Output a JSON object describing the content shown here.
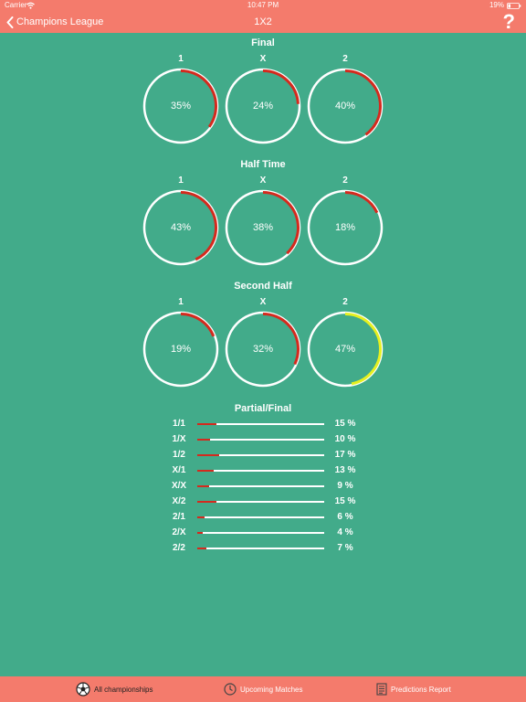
{
  "status": {
    "carrier": "Carrier",
    "time": "10:47 PM",
    "battery": "19%"
  },
  "nav": {
    "back_label": "Champions League",
    "title": "1X2",
    "help": "?"
  },
  "colors": {
    "background": "#42ab8a",
    "bar": "#f47b6c",
    "arc_red": "#d42a1e",
    "arc_yellow": "#e6f020"
  },
  "sections": [
    {
      "title": "Final",
      "gauges": [
        {
          "label": "1",
          "value": "35%",
          "fraction": 0.35,
          "highlight": false
        },
        {
          "label": "X",
          "value": "24%",
          "fraction": 0.24,
          "highlight": false
        },
        {
          "label": "2",
          "value": "40%",
          "fraction": 0.4,
          "highlight": false
        }
      ]
    },
    {
      "title": "Half Time",
      "gauges": [
        {
          "label": "1",
          "value": "43%",
          "fraction": 0.43,
          "highlight": false
        },
        {
          "label": "X",
          "value": "38%",
          "fraction": 0.38,
          "highlight": false
        },
        {
          "label": "2",
          "value": "18%",
          "fraction": 0.18,
          "highlight": false
        }
      ]
    },
    {
      "title": "Second Half",
      "gauges": [
        {
          "label": "1",
          "value": "19%",
          "fraction": 0.19,
          "highlight": false
        },
        {
          "label": "X",
          "value": "32%",
          "fraction": 0.32,
          "highlight": false
        },
        {
          "label": "2",
          "value": "47%",
          "fraction": 0.47,
          "highlight": true
        }
      ]
    }
  ],
  "partial_final": {
    "title": "Partial/Final",
    "rows": [
      {
        "label": "1/1",
        "value": "15 %",
        "fraction": 0.15
      },
      {
        "label": "1/X",
        "value": "10 %",
        "fraction": 0.1
      },
      {
        "label": "1/2",
        "value": "17 %",
        "fraction": 0.17
      },
      {
        "label": "X/1",
        "value": "13 %",
        "fraction": 0.13
      },
      {
        "label": "X/X",
        "value": "9 %",
        "fraction": 0.09
      },
      {
        "label": "X/2",
        "value": "15 %",
        "fraction": 0.15
      },
      {
        "label": "2/1",
        "value": "6 %",
        "fraction": 0.06
      },
      {
        "label": "2/X",
        "value": "4 %",
        "fraction": 0.04
      },
      {
        "label": "2/2",
        "value": "7 %",
        "fraction": 0.07
      }
    ]
  },
  "tabs": [
    {
      "label": "All championships",
      "icon": "soccer-ball-icon",
      "active": true
    },
    {
      "label": "Upcoming Matches",
      "icon": "clock-icon",
      "active": false
    },
    {
      "label": "Predictions Report",
      "icon": "report-icon",
      "active": false
    }
  ]
}
